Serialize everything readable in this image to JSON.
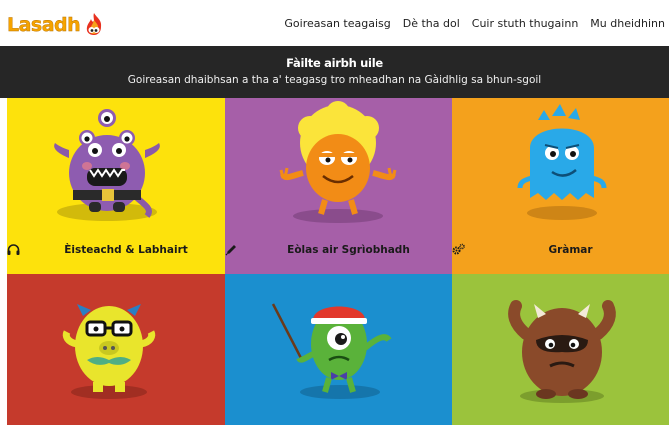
{
  "brand": {
    "name": "Lasadh"
  },
  "nav": {
    "items": [
      {
        "label": "Goireasan teagaisg"
      },
      {
        "label": "Dè tha dol"
      },
      {
        "label": "Cuir stuth thugainn"
      },
      {
        "label": "Mu dheidhinn"
      }
    ]
  },
  "banner": {
    "title": "Fàilte airbh uile",
    "subtitle": "Goireasan dhaibhsan a tha a' teagasg tro mheadhan na Gàidhlig sa bhun-sgoil"
  },
  "tiles": [
    {
      "label": "Èisteachd & Labhairt",
      "icon": "headphones-icon",
      "color": "#fde20c"
    },
    {
      "label": "Eòlas air Sgrìobhadh",
      "icon": "pencil-icon",
      "color": "#a65fa8"
    },
    {
      "label": "Gràmar",
      "icon": "gears-icon",
      "color": "#f4a11c"
    },
    {
      "label": "",
      "icon": "",
      "color": "#c53a2c"
    },
    {
      "label": "",
      "icon": "",
      "color": "#1b8fcf"
    },
    {
      "label": "",
      "icon": "",
      "color": "#9bc33c"
    }
  ],
  "colors": {
    "header_bg": "#ffffff",
    "banner_bg": "#262626",
    "logo": "#f5a300"
  }
}
